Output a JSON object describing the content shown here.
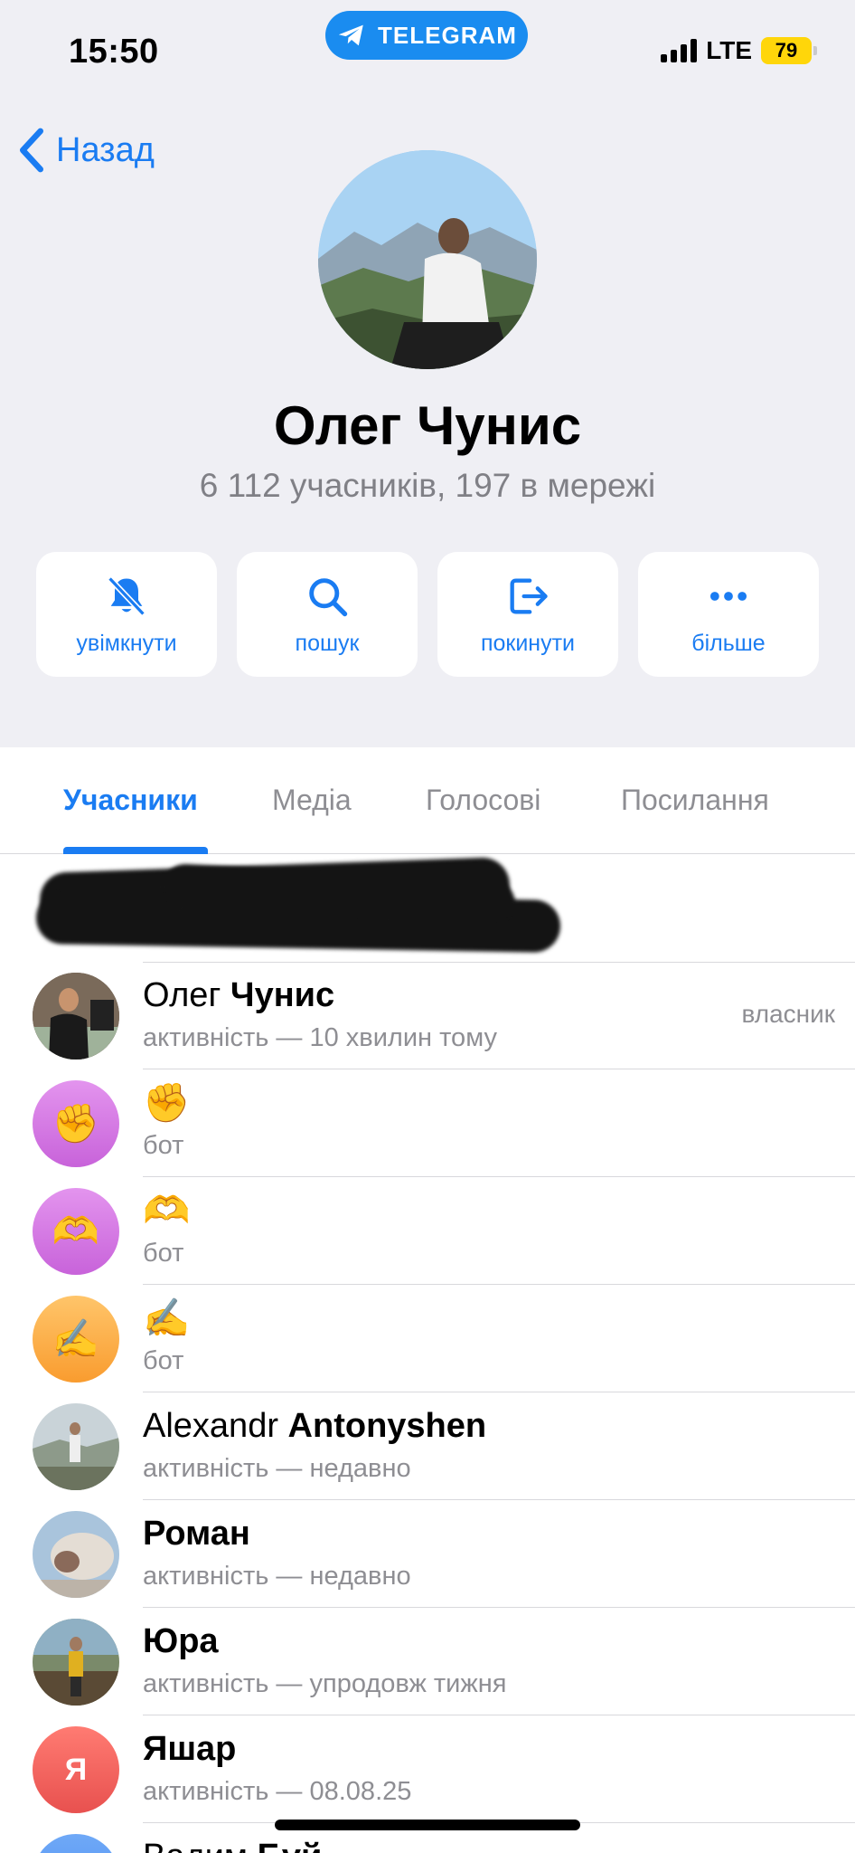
{
  "status_bar": {
    "time": "15:50",
    "app_pill": "TELEGRAM",
    "network": "LTE",
    "battery": "79"
  },
  "header": {
    "back_label": "Назад",
    "group_name": "Олег Чунис",
    "subtitle": "6 112 учасників, 197 в мережі"
  },
  "actions": [
    {
      "label": "увімкнути",
      "icon": "bell-slash-icon"
    },
    {
      "label": "пошук",
      "icon": "search-icon"
    },
    {
      "label": "покинути",
      "icon": "leave-icon"
    },
    {
      "label": "більше",
      "icon": "more-icon"
    }
  ],
  "tabs": [
    {
      "label": "Учасники",
      "active": true
    },
    {
      "label": "Медіа",
      "active": false
    },
    {
      "label": "Голосові",
      "active": false
    },
    {
      "label": "Посилання",
      "active": false
    }
  ],
  "members": [
    {
      "first": "Олег",
      "last": "Чунис",
      "status": "активність — 10 хвилин тому",
      "role": "власник",
      "avatar": "photo",
      "color": "#5a4a3a"
    },
    {
      "first": "✊",
      "last": "",
      "status": "бот",
      "role": "",
      "avatar": "emoji",
      "emoji": "✊",
      "color": "#d77be0"
    },
    {
      "first": "🫶",
      "last": "",
      "status": "бот",
      "role": "",
      "avatar": "emoji",
      "emoji": "🫶",
      "color": "#d77be0"
    },
    {
      "first": "✍️",
      "last": "",
      "status": "бот",
      "role": "",
      "avatar": "emoji",
      "emoji": "✍️",
      "color": "#fbb24a"
    },
    {
      "first": "Alexandr",
      "last": "Antonyshen",
      "status": "активність — недавно",
      "role": "",
      "avatar": "photo",
      "color": "#8ea0a8"
    },
    {
      "first": "Роман",
      "last": "",
      "status": "активність — недавно",
      "role": "",
      "avatar": "photo",
      "color": "#b8b0a8"
    },
    {
      "first": "Юра",
      "last": "",
      "status": "активність — упродовж тижня",
      "role": "",
      "avatar": "photo",
      "color": "#6a6a55"
    },
    {
      "first": "Яшар",
      "last": "",
      "status": "активність — 08.08.25",
      "role": "",
      "avatar": "letter",
      "emoji": "Я",
      "color": "#f2625f"
    },
    {
      "first": "Вадим",
      "last": "Бүй",
      "status": "",
      "role": "",
      "avatar": "letter",
      "emoji": "",
      "color": "#5c9cf5"
    }
  ]
}
